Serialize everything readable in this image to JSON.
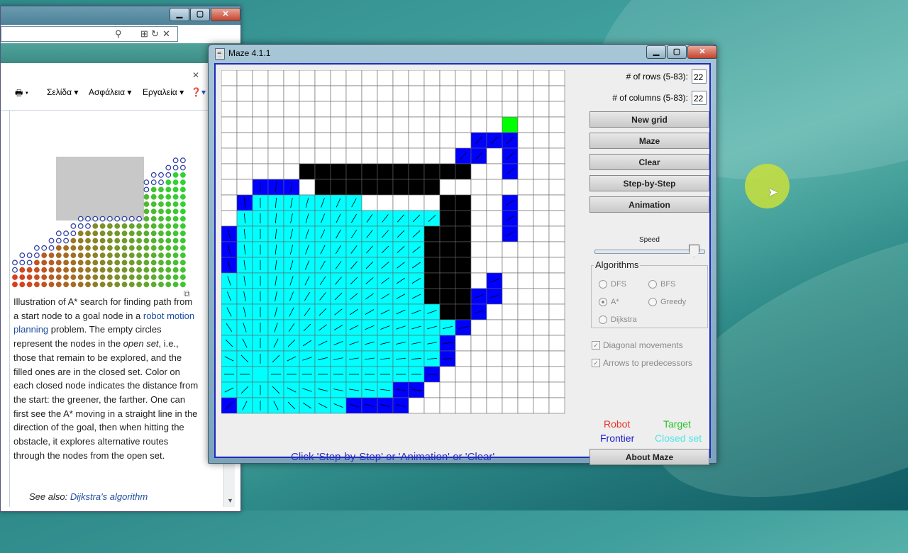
{
  "browser": {
    "menu": [
      "Σελίδα",
      "Ασφάλεια",
      "Εργαλεία"
    ],
    "caption_parts": [
      {
        "text": "Illustration of A* search for finding path from a start node to a goal node in a ",
        "style": "plain"
      },
      {
        "text": "robot motion planning",
        "style": "link"
      },
      {
        "text": " problem. The empty circles represent the nodes in the ",
        "style": "plain"
      },
      {
        "text": "open set",
        "style": "em"
      },
      {
        "text": ", i.e., those that remain to be explored, and the filled ones are in the closed set. Color on each closed node indicates the distance from the start: the greener, the farther. One can first see the A* moving in a straight line in the direction of the goal, then when hitting the obstacle, it explores alternative routes through the nodes from the open set.",
        "style": "plain"
      }
    ],
    "see_also_label": "See also: ",
    "see_also_link": "Dijkstra's algorithm"
  },
  "maze": {
    "title": "Maze 4.1.1",
    "rows_label": "# of rows (5-83):",
    "rows_value": "22",
    "cols_label": "# of columns (5-83):",
    "cols_value": "22",
    "buttons": {
      "new_grid": "New grid",
      "maze": "Maze",
      "clear": "Clear",
      "step": "Step-by-Step",
      "animation": "Animation",
      "about": "About Maze"
    },
    "speed_label": "Speed",
    "speed_value": 0.92,
    "algorithms_title": "Algorithms",
    "algorithms": [
      "DFS",
      "BFS",
      "A*",
      "Greedy",
      "Dijkstra"
    ],
    "selected_algorithm": "A*",
    "diagonal_label": "Diagonal movements",
    "arrows_label": "Arrows to predecessors",
    "legend": {
      "robot": "Robot",
      "target": "Target",
      "frontier": "Frontier",
      "closed": "Closed set"
    },
    "message": "Click 'Step-by-Step' or 'Animation' or 'Clear'",
    "grid": {
      "rows": 22,
      "cols": 22,
      "target": [
        3,
        18
      ],
      "walls": [
        [
          6,
          5,
          6,
          15
        ],
        [
          7,
          6,
          7,
          13
        ],
        [
          8,
          14,
          15,
          15
        ],
        [
          10,
          13,
          14,
          15
        ]
      ],
      "closed_rows": [
        [
          8,
          2,
          8
        ],
        [
          9,
          1,
          13
        ],
        [
          10,
          1,
          12
        ],
        [
          11,
          1,
          12
        ],
        [
          12,
          1,
          12
        ],
        [
          13,
          0,
          12
        ],
        [
          14,
          0,
          15
        ],
        [
          15,
          0,
          15
        ],
        [
          16,
          0,
          14
        ],
        [
          17,
          0,
          13
        ],
        [
          18,
          0,
          13
        ],
        [
          19,
          0,
          13
        ],
        [
          20,
          0,
          11
        ],
        [
          21,
          1,
          7
        ]
      ],
      "frontier": [
        [
          4,
          16
        ],
        [
          4,
          17
        ],
        [
          4,
          18
        ],
        [
          5,
          15
        ],
        [
          5,
          16
        ],
        [
          5,
          18
        ],
        [
          6,
          18
        ],
        [
          7,
          2
        ],
        [
          7,
          3
        ],
        [
          7,
          4
        ],
        [
          8,
          1
        ],
        [
          8,
          18
        ],
        [
          9,
          18
        ],
        [
          10,
          0
        ],
        [
          10,
          18
        ],
        [
          11,
          0
        ],
        [
          12,
          0
        ],
        [
          13,
          17
        ],
        [
          14,
          16
        ],
        [
          14,
          17
        ],
        [
          15,
          16
        ],
        [
          16,
          15
        ],
        [
          17,
          14
        ],
        [
          18,
          14
        ],
        [
          19,
          13
        ],
        [
          20,
          12
        ],
        [
          21,
          0
        ],
        [
          21,
          8
        ],
        [
          21,
          9
        ],
        [
          21,
          10
        ],
        [
          21,
          11
        ],
        [
          20,
          11
        ]
      ]
    }
  }
}
